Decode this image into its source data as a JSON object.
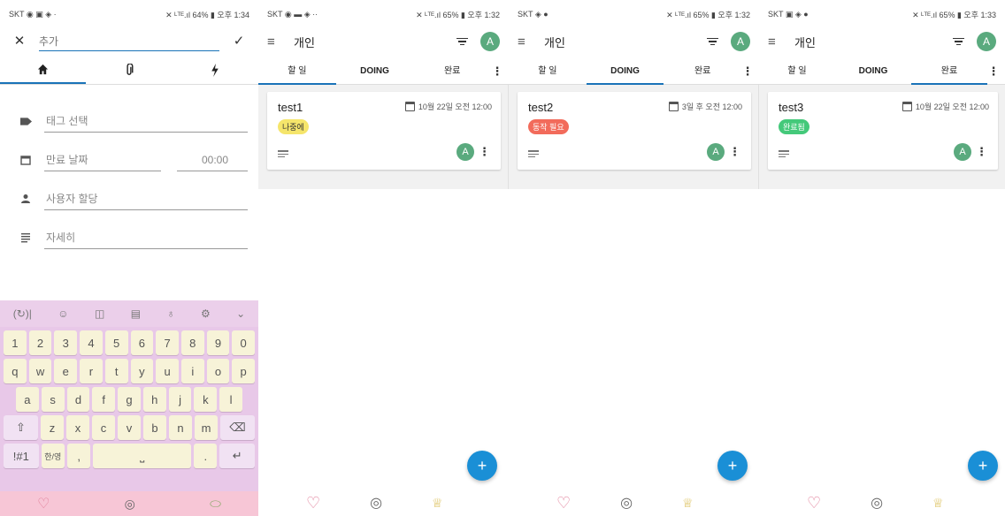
{
  "screens": {
    "add": {
      "status_left": "SKT ◉ ▣ ◈ ·",
      "status_right": "✕ ᴸᵀᴱ.ıl 64% ▮ 오후 1:34",
      "input_placeholder": "추가",
      "fields": {
        "tag": "태그 선택",
        "due_date": "만료 날짜",
        "due_time": "00:00",
        "assign": "사용자 할당",
        "details": "자세히"
      },
      "keyboard": {
        "number_row": [
          "1",
          "2",
          "3",
          "4",
          "5",
          "6",
          "7",
          "8",
          "9",
          "0"
        ],
        "row1": [
          "q",
          "w",
          "e",
          "r",
          "t",
          "y",
          "u",
          "i",
          "o",
          "p"
        ],
        "row2": [
          "a",
          "s",
          "d",
          "f",
          "g",
          "h",
          "j",
          "k",
          "l"
        ],
        "row3": [
          "z",
          "x",
          "c",
          "v",
          "b",
          "n",
          "m"
        ],
        "symbols_key": "!#1",
        "lang_key": "한/영",
        "comma": ",",
        "period": "."
      }
    },
    "todo": {
      "status_left": "SKT ◉ ▬ ◈ ··",
      "status_right": "✕ ᴸᵀᴱ.ıl 65% ▮ 오후 1:32",
      "title": "개인",
      "avatar": "A",
      "tabs": [
        "할 일",
        "DOING",
        "완료"
      ],
      "card": {
        "title": "test1",
        "date": "10월 22일 오전 12:00",
        "tag": "나중에",
        "tag_color": "#f5e56b"
      }
    },
    "doing": {
      "status_left": "SKT ◈ ●",
      "status_right": "✕ ᴸᵀᴱ.ıl 65% ▮ 오후 1:32",
      "title": "개인",
      "avatar": "A",
      "tabs": [
        "할 일",
        "DOING",
        "완료"
      ],
      "card": {
        "title": "test2",
        "date": "3일 후 오전 12:00",
        "tag": "동작 필요",
        "tag_color": "#f26b5b"
      }
    },
    "done": {
      "status_left": "SKT ▣ ◈ ●",
      "status_right": "✕ ᴸᵀᴱ.ıl 65% ▮ 오후 1:33",
      "title": "개인",
      "avatar": "A",
      "tabs": [
        "할 일",
        "DOING",
        "완료"
      ],
      "card": {
        "title": "test3",
        "date": "10월 22일 오전 12:00",
        "tag": "완료됨",
        "tag_color": "#44c97a"
      }
    }
  },
  "colors": {
    "accent": "#1a73b8",
    "fab": "#1a8fd6",
    "avatar": "#5aaa7e",
    "keyboard": "#e8c8e8"
  }
}
